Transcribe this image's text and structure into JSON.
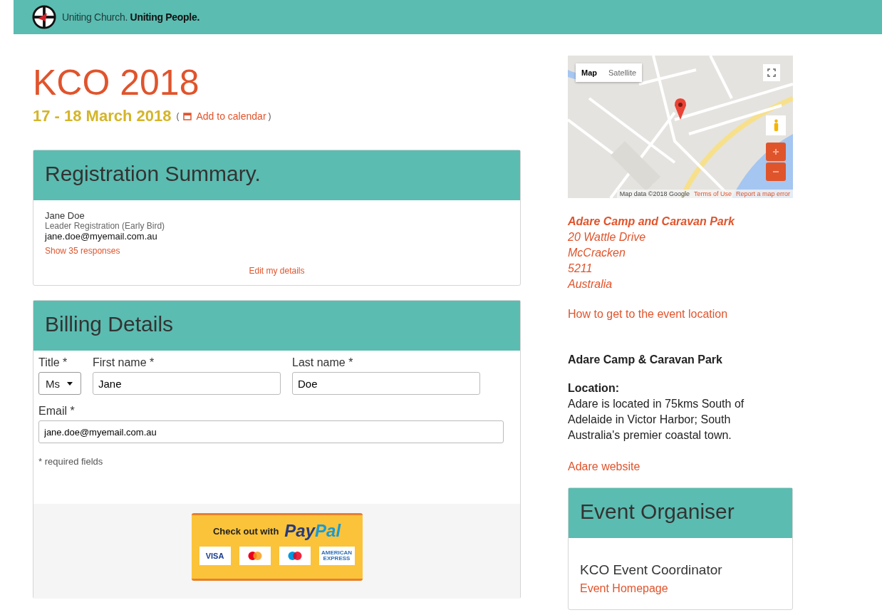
{
  "header": {
    "tagline_light": "Uniting Church.",
    "tagline_bold": "Uniting People."
  },
  "event": {
    "title": "KCO 2018",
    "dates": "17 - 18 March 2018",
    "calendar_open": "(",
    "calendar_link": "Add to calendar",
    "calendar_close": ")"
  },
  "summary": {
    "heading": "Registration Summary.",
    "name": "Jane Doe",
    "registration": "Leader Registration (Early Bird)",
    "email": "jane.doe@myemail.com.au",
    "responses_link": "Show 35 responses",
    "edit_link": "Edit my details"
  },
  "billing": {
    "heading": "Billing Details",
    "fields": [
      {
        "kind": "select",
        "label": "Title *",
        "value": "Ms"
      },
      {
        "kind": "text",
        "label": "First name *",
        "value": "Jane"
      },
      {
        "kind": "text",
        "label": "Last name *",
        "value": "Doe"
      },
      {
        "kind": "wide",
        "label": "Email *",
        "value": "jane.doe@myemail.com.au"
      }
    ],
    "note": "* required fields"
  },
  "paypal": {
    "prefix": "Check out with",
    "brand_dark": "Pay",
    "brand_light": "Pal",
    "cards": [
      {
        "kind": "visa",
        "text": "VISA"
      },
      {
        "kind": "mastercard"
      },
      {
        "kind": "maestro"
      },
      {
        "kind": "amex",
        "text": "AMERICAN EXPRESS"
      }
    ]
  },
  "map": {
    "tabs": [
      {
        "label": "Map",
        "selected": true
      },
      {
        "label": "Satellite",
        "selected": false
      }
    ],
    "data_credit": "Map data ©2018 Google",
    "terms": "Terms of Use",
    "report": "Report a map error"
  },
  "venue": {
    "name": "Adare Camp and Caravan Park",
    "address": [
      "20 Wattle Drive",
      "McCracken",
      "5211",
      "Australia"
    ],
    "directions": "How to get to the event location",
    "title": "Adare Camp & Caravan Park",
    "location_label": "Location:",
    "location_text": "Adare is located in 75kms South of Adelaide in Victor Harbor; South Australia's premier coastal town.",
    "website": "Adare website"
  },
  "organiser": {
    "heading": "Event Organiser",
    "name": "KCO Event Coordinator",
    "homepage": "Event Homepage"
  }
}
